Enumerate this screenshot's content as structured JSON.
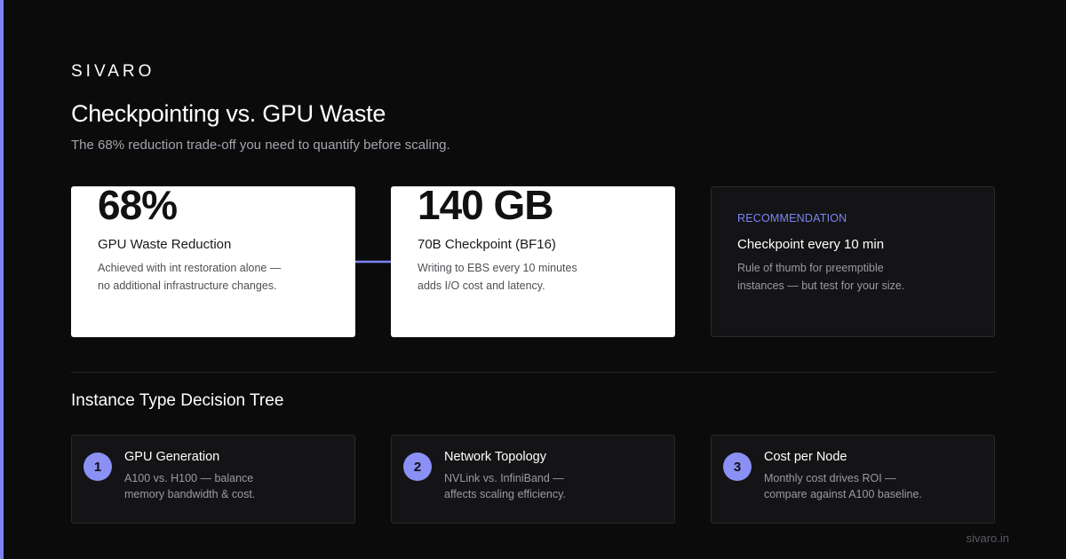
{
  "brand": "SIVARO",
  "header": {
    "title": "Checkpointing vs. GPU Waste",
    "subtitle": "The 68% reduction trade-off you need to quantify before scaling."
  },
  "cards": [
    {
      "value": "68%",
      "label": "GPU Waste Reduction",
      "desc_lines": [
        "Achieved with int restoration alone —",
        "no additional infrastructure changes."
      ]
    },
    {
      "value": "140 GB",
      "label": "70B Checkpoint (BF16)",
      "desc_lines": [
        "Writing to EBS every 10 minutes",
        "adds I/O cost and latency."
      ]
    },
    {
      "kicker": "RECOMMENDATION",
      "label": "Checkpoint every 10 min",
      "desc_lines": [
        "Rule of thumb for preemptible",
        "instances — but test for your size."
      ]
    }
  ],
  "decision_tree": {
    "title": "Instance Type Decision Tree",
    "steps": [
      {
        "number": "1",
        "title": "GPU Generation",
        "desc_lines": [
          "A100 vs. H100 — balance",
          "memory bandwidth & cost."
        ]
      },
      {
        "number": "2",
        "title": "Network Topology",
        "desc_lines": [
          "NVLink vs. InfiniBand —",
          "affects scaling efficiency."
        ]
      },
      {
        "number": "3",
        "title": "Cost per Node",
        "desc_lines": [
          "Monthly cost drives ROI —",
          "compare against A100 baseline."
        ]
      }
    ]
  },
  "footer": {
    "url": "sivaro.in"
  },
  "colors": {
    "background": "#0b0b0c",
    "accent": "#7c84f5",
    "badge": "#8a90f4",
    "card_light": "#ffffff",
    "card_dark": "#141416"
  },
  "icons": {
    "connector": "arrow-right-icon"
  }
}
